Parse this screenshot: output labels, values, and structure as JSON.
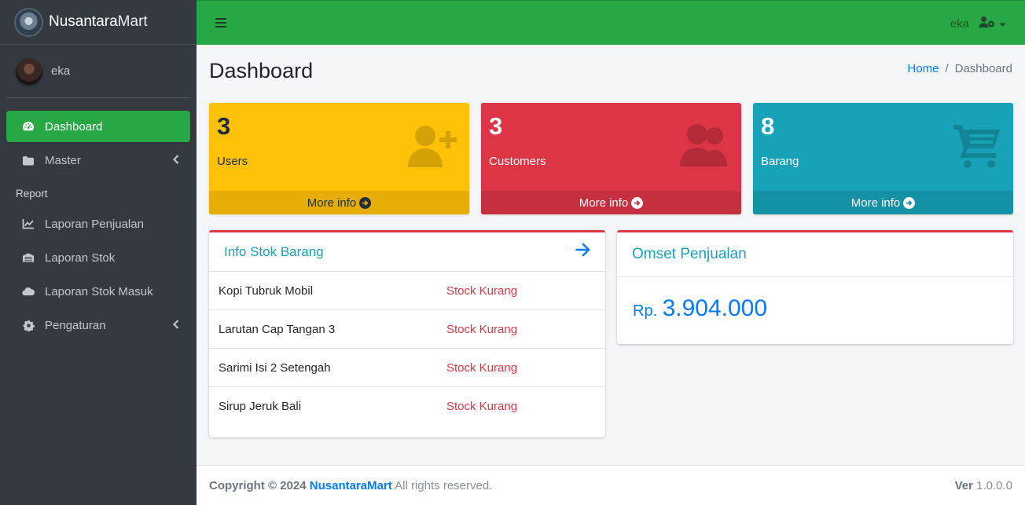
{
  "app": {
    "brand_bold": "Nusantara",
    "brand_light": "Mart"
  },
  "sidebar": {
    "user_name": "eka",
    "items": [
      {
        "label": "Dashboard",
        "icon": "tachometer-icon"
      },
      {
        "label": "Master",
        "icon": "folder-icon"
      },
      {
        "label": "Report"
      },
      {
        "label": "Laporan Penjualan",
        "icon": "chart-line-icon"
      },
      {
        "label": "Laporan Stok",
        "icon": "warehouse-icon"
      },
      {
        "label": "Laporan Stok Masuk",
        "icon": "cloud-icon"
      },
      {
        "label": "Pengaturan",
        "icon": "gear-icon"
      }
    ]
  },
  "topbar": {
    "user_name": "eka"
  },
  "page": {
    "title": "Dashboard",
    "breadcrumb": [
      "Home",
      "/",
      "Dashboard"
    ]
  },
  "stats": [
    {
      "value": "3",
      "label": "Users",
      "more": "More info",
      "icon": "user-plus-icon",
      "color": "#ffc107"
    },
    {
      "value": "3",
      "label": "Customers",
      "more": "More info",
      "icon": "users-icon",
      "color": "#dc3545"
    },
    {
      "value": "8",
      "label": "Barang",
      "more": "More info",
      "icon": "shopping-cart-icon",
      "color": "#17a2b8"
    }
  ],
  "stok": {
    "title": "Info Stok Barang",
    "rows": [
      {
        "name": "Kopi Tubruk Mobil",
        "status": "Stock Kurang"
      },
      {
        "name": "Larutan Cap Tangan 3",
        "status": "Stock Kurang"
      },
      {
        "name": "Sarimi Isi 2 Setengah",
        "status": "Stock Kurang"
      },
      {
        "name": "Sirup Jeruk Bali",
        "status": "Stock Kurang"
      }
    ]
  },
  "omset": {
    "title": "Omset Penjualan",
    "currency": "Rp.",
    "amount": "3.904.000"
  },
  "footer": {
    "copyright": "Copyright © 2024",
    "brand": "NusantaraMart",
    "rights": "All rights reserved.",
    "ver_label": "Ver",
    "ver_value": "1.0.0.0"
  },
  "colors": {
    "accent": "#28a745",
    "sidebar_bg": "#343a40",
    "link": "#007bff",
    "danger": "#dc3545",
    "info": "#17a2b8",
    "warning": "#ffc107"
  }
}
